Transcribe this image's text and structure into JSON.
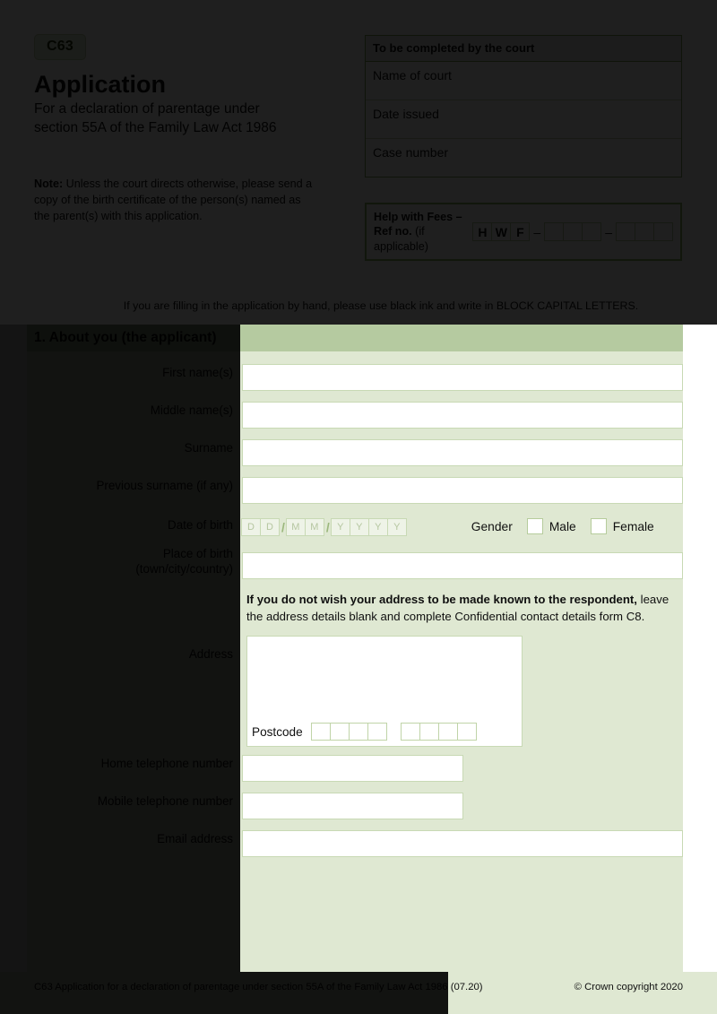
{
  "header": {
    "form_code": "C63",
    "title": "Application",
    "subtitle_line1": "For a declaration of parentage under",
    "subtitle_line2": "section 55A of the Family Law Act 1986",
    "note_bold": "Note:",
    "note_text": " Unless the court directs otherwise, please send a copy of the birth certificate of the person(s) named as the parent(s) with this application."
  },
  "court_box": {
    "heading": "To be completed by the court",
    "rows": [
      {
        "label": "Name of court",
        "value": ""
      },
      {
        "label": "Date issued",
        "value": ""
      },
      {
        "label": "Case number",
        "value": ""
      }
    ]
  },
  "hwf": {
    "label_line1": "Help with Fees –",
    "label_line2_bold": "Ref no.",
    "label_line2_light": " (if applicable)",
    "prefix_cells": [
      "H",
      "W",
      "F"
    ],
    "dash": "–",
    "group1_cells": 3,
    "group2_cells": 3
  },
  "instruction": "If you are filling in the application by hand, please use black ink and write in BLOCK CAPITAL LETTERS.",
  "section": {
    "title": "1. About you (the applicant)"
  },
  "fields": {
    "first_names": {
      "label": "First name(s)",
      "value": ""
    },
    "middle_names": {
      "label": "Middle name(s)",
      "value": ""
    },
    "surname": {
      "label": "Surname",
      "value": ""
    },
    "previous_surname": {
      "label": "Previous surname (if any)",
      "value": ""
    },
    "date_of_birth": {
      "label": "Date of birth",
      "placeholders": [
        "D",
        "D",
        "M",
        "M",
        "Y",
        "Y",
        "Y",
        "Y"
      ]
    },
    "gender": {
      "label": "Gender",
      "options": [
        "Male",
        "Female"
      ],
      "selected": ""
    },
    "place_of_birth": {
      "label_line1": "Place of birth",
      "label_line2": "(town/city/country)",
      "value": ""
    },
    "address": {
      "label": "Address",
      "value": "",
      "postcode_label": "Postcode",
      "postcode_cells_group1": 4,
      "postcode_cells_group2": 4
    },
    "home_phone": {
      "label": "Home telephone number",
      "value": ""
    },
    "mobile_phone": {
      "label": "Mobile telephone number",
      "value": ""
    },
    "email": {
      "label": "Email address",
      "value": ""
    }
  },
  "address_note": {
    "bold": "If you do not wish your address to be made known to the respondent,",
    "rest": " leave the address details blank and complete Confidential contact details form C8."
  },
  "footer": {
    "left": "C63 Application for a declaration of parentage under section 55A of the Family Law Act 1986 (07.20)",
    "right": "© Crown copyright 2020"
  },
  "colors": {
    "section_bar": "#b5caa0",
    "form_bg": "#dfe8d2",
    "border_green": "#7fa055",
    "code_badge": "#dfe9d2"
  }
}
